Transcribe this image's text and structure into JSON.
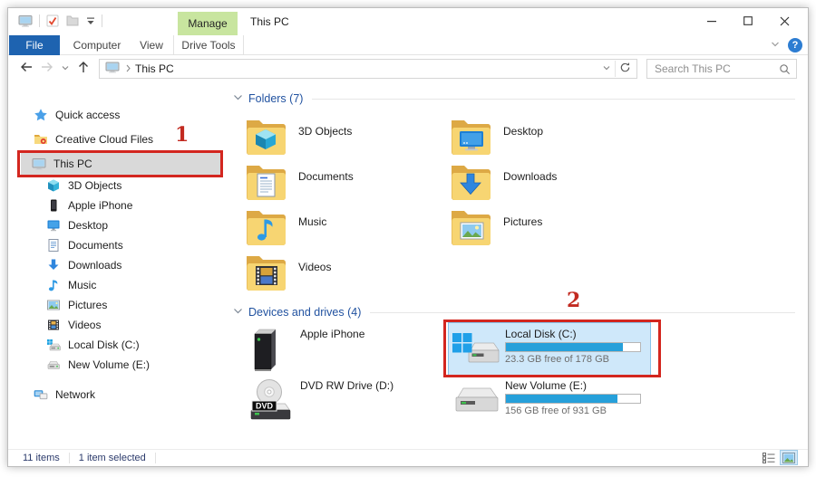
{
  "window": {
    "title": "This PC"
  },
  "ribbon": {
    "manage_label": "Manage",
    "tabs": [
      {
        "label": "File"
      },
      {
        "label": "Computer"
      },
      {
        "label": "View"
      },
      {
        "label": "Drive Tools"
      }
    ],
    "help_label": "?"
  },
  "address_bar": {
    "path_root": "This PC",
    "search_placeholder": "Search This PC"
  },
  "sidebar": {
    "items": [
      {
        "label": "Quick access"
      },
      {
        "label": "Creative Cloud Files"
      },
      {
        "label": "This PC"
      },
      {
        "label": "3D Objects"
      },
      {
        "label": "Apple iPhone"
      },
      {
        "label": "Desktop"
      },
      {
        "label": "Documents"
      },
      {
        "label": "Downloads"
      },
      {
        "label": "Music"
      },
      {
        "label": "Pictures"
      },
      {
        "label": "Videos"
      },
      {
        "label": "Local Disk (C:)"
      },
      {
        "label": "New Volume (E:)"
      },
      {
        "label": "Network"
      }
    ]
  },
  "content": {
    "folders_header": "Folders (7)",
    "folders": [
      {
        "name": "3D Objects"
      },
      {
        "name": "Desktop"
      },
      {
        "name": "Documents"
      },
      {
        "name": "Downloads"
      },
      {
        "name": "Music"
      },
      {
        "name": "Pictures"
      },
      {
        "name": "Videos"
      }
    ],
    "devices_header": "Devices and drives (4)",
    "devices": [
      {
        "name": "Apple iPhone"
      },
      {
        "name": "Local Disk (C:)",
        "capacity": "23.3 GB free of 178 GB",
        "used_pct": 87
      },
      {
        "name": "DVD RW Drive (D:)",
        "disc_label": "DVD"
      },
      {
        "name": "New Volume (E:)",
        "capacity": "156 GB free of 931 GB",
        "used_pct": 83
      }
    ]
  },
  "status_bar": {
    "items_count": "11 items",
    "selection": "1 item selected"
  },
  "annotations": {
    "step_1": "1",
    "step_2": "2"
  },
  "colors": {
    "accent_blue": "#1e63b0",
    "manage_green": "#c8e59f",
    "selection_blue": "#cfe8fa",
    "bar_fill": "#26a0da",
    "annotation_red": "#d3261f",
    "sidebar_selected": "#d9d9d9"
  }
}
